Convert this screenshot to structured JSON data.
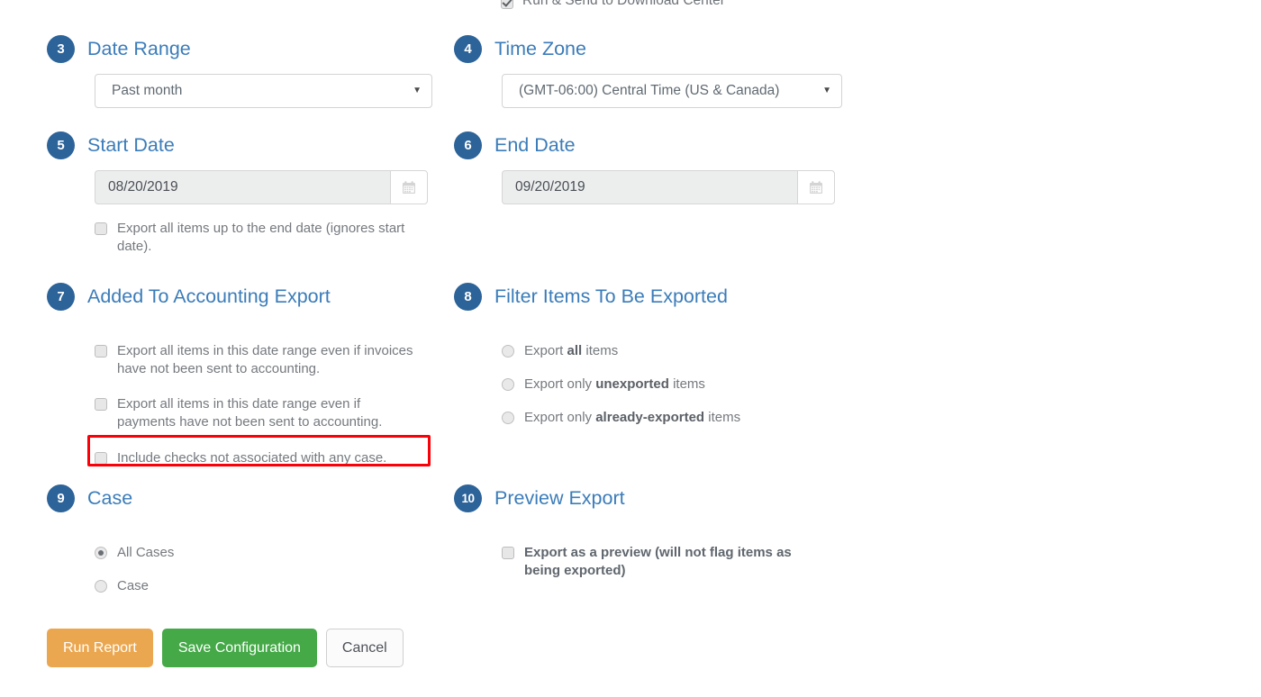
{
  "top_partial": {
    "checkbox_label": "Run & Send to Download Center",
    "checked": true
  },
  "sections": {
    "date_range": {
      "number": "3",
      "title": "Date Range",
      "select_value": "Past month",
      "caret_icon": "chevron-down-icon"
    },
    "time_zone": {
      "number": "4",
      "title": "Time Zone",
      "select_value": "(GMT-06:00) Central Time (US & Canada)",
      "caret_icon": "chevron-down-icon"
    },
    "start_date": {
      "number": "5",
      "title": "Start Date",
      "value": "08/20/2019",
      "calendar_icon": "calendar-icon",
      "checkbox_label": "Export all items up to the end date (ignores start date).",
      "checked": false
    },
    "end_date": {
      "number": "6",
      "title": "End Date",
      "value": "09/20/2019",
      "calendar_icon": "calendar-icon"
    },
    "accounting_export": {
      "number": "7",
      "title": "Added To Accounting Export",
      "options": [
        {
          "label": "Export all items in this date range even if invoices have not been sent to accounting.",
          "checked": false
        },
        {
          "label": "Export all items in this date range even if payments have not been sent to accounting.",
          "checked": false
        },
        {
          "label": "Include checks not associated with any case.",
          "checked": false,
          "highlighted": true
        }
      ]
    },
    "filter_items": {
      "number": "8",
      "title": "Filter Items To Be Exported",
      "options": [
        {
          "prefix": "Export ",
          "bold": "all",
          "suffix": " items",
          "checked": false
        },
        {
          "prefix": "Export only ",
          "bold": "unexported",
          "suffix": " items",
          "checked": false
        },
        {
          "prefix": "Export only ",
          "bold": "already-exported",
          "suffix": " items",
          "checked": false
        }
      ]
    },
    "case": {
      "number": "9",
      "title": "Case",
      "options": [
        {
          "label": "All Cases",
          "checked": true
        },
        {
          "label": "Case",
          "checked": false
        }
      ]
    },
    "preview_export": {
      "number": "10",
      "title": "Preview Export",
      "checkbox_label": "Export as a preview (will not flag items as being exported)",
      "checked": false
    }
  },
  "buttons": {
    "run_report": "Run Report",
    "save_configuration": "Save Configuration",
    "cancel": "Cancel"
  },
  "colors": {
    "badge_blue": "#2c6399",
    "heading_blue": "#3b7cb9",
    "run_orange": "#eba750",
    "save_green": "#45a948",
    "highlight_red": "#fb0007"
  }
}
